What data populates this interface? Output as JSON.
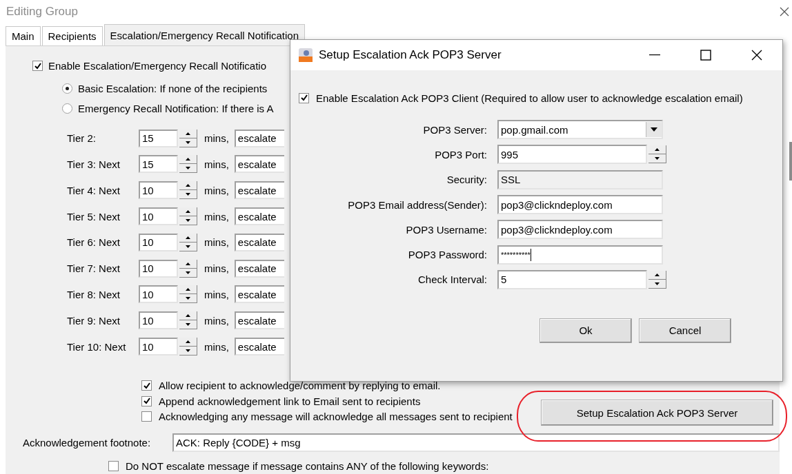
{
  "window": {
    "title": "Editing Group"
  },
  "tabs": [
    {
      "label": "Main",
      "selected": false
    },
    {
      "label": "Recipients",
      "selected": false
    },
    {
      "label": "Escalation/Emergency Recall Notification",
      "selected": true
    }
  ],
  "escalation": {
    "enable": {
      "label": "Enable Escalation/Emergency Recall Notificatio",
      "checked": true
    },
    "modes": [
      {
        "label": "Basic Escalation: If none of the recipients",
        "selected": true
      },
      {
        "label": "Emergency Recall Notification: If there is A",
        "selected": false
      }
    ],
    "tiers": [
      {
        "label": "Tier 2:",
        "minutes": "15",
        "unit": "mins,",
        "action": "escalate"
      },
      {
        "label": "Tier 3: Next",
        "minutes": "15",
        "unit": "mins,",
        "action": "escalate"
      },
      {
        "label": "Tier 4: Next",
        "minutes": "10",
        "unit": "mins,",
        "action": "escalate"
      },
      {
        "label": "Tier 5: Next",
        "minutes": "10",
        "unit": "mins,",
        "action": "escalate"
      },
      {
        "label": "Tier 6: Next",
        "minutes": "10",
        "unit": "mins,",
        "action": "escalate"
      },
      {
        "label": "Tier 7: Next",
        "minutes": "10",
        "unit": "mins,",
        "action": "escalate"
      },
      {
        "label": "Tier 8: Next",
        "minutes": "10",
        "unit": "mins,",
        "action": "escalate"
      },
      {
        "label": "Tier 9: Next",
        "minutes": "10",
        "unit": "mins,",
        "action": "escalate"
      },
      {
        "label": "Tier 10: Next",
        "minutes": "10",
        "unit": "mins,",
        "action": "escalate"
      }
    ]
  },
  "options": [
    {
      "label": "Allow recipient to acknowledge/comment by replying to email.",
      "checked": true
    },
    {
      "label": "Append acknowledgement link to Email sent to recipients",
      "checked": true
    },
    {
      "label": "Acknowledging any message will acknowledge all messages sent to recipient",
      "checked": false
    }
  ],
  "setup_button": "Setup Escalation Ack POP3 Server",
  "footnote": {
    "label": "Acknowledgement footnote:",
    "value": "ACK: Reply {CODE} + msg"
  },
  "keyword_filter": {
    "label": "Do NOT escalate message if message contains ANY of the following keywords:",
    "checked": false
  },
  "dialog": {
    "title": "Setup Escalation Ack POP3 Server",
    "enable": {
      "label": "Enable Escalation Ack POP3 Client (Required to allow user to acknowledge escalation email)",
      "checked": true
    },
    "fields": [
      {
        "label": "POP3 Server:",
        "value": "pop.gmail.com",
        "kind": "combo"
      },
      {
        "label": "POP3 Port:",
        "value": "995",
        "kind": "spin"
      },
      {
        "label": "Security:",
        "value": "SSL",
        "kind": "readonly"
      },
      {
        "label": "POP3 Email address(Sender):",
        "value": "pop3@clickndeploy.com",
        "kind": "text"
      },
      {
        "label": "POP3 Username:",
        "value": "pop3@clickndeploy.com",
        "kind": "text"
      },
      {
        "label": "POP3 Password:",
        "value": "**********",
        "kind": "password"
      },
      {
        "label": "Check Interval:",
        "value": "5",
        "kind": "spin"
      }
    ],
    "buttons": [
      "Ok",
      "Cancel"
    ]
  }
}
